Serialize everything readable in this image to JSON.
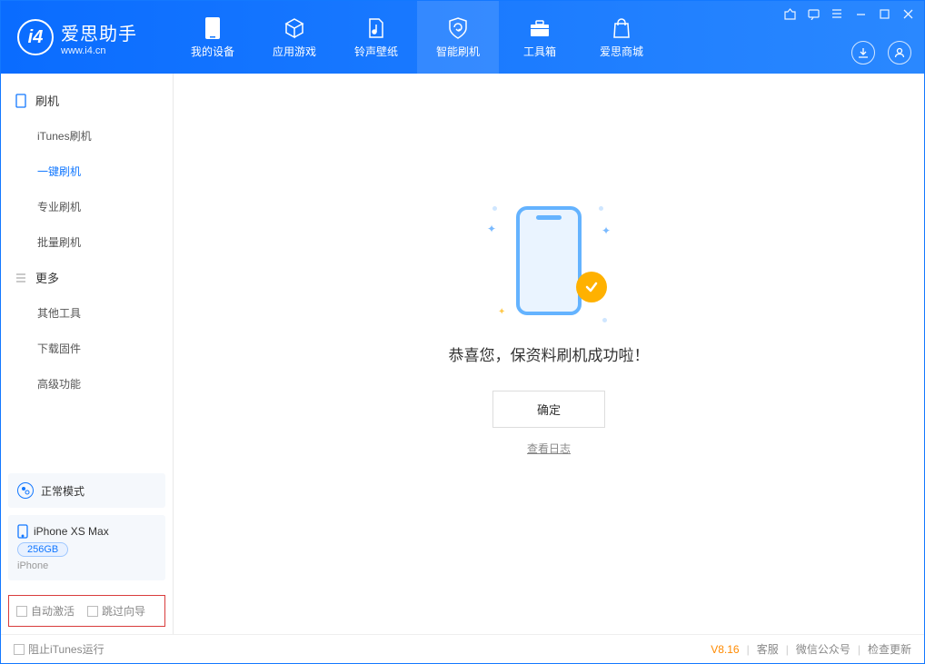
{
  "app": {
    "title": "爱思助手",
    "url": "www.i4.cn"
  },
  "nav": [
    {
      "label": "我的设备"
    },
    {
      "label": "应用游戏"
    },
    {
      "label": "铃声壁纸"
    },
    {
      "label": "智能刷机",
      "active": true
    },
    {
      "label": "工具箱"
    },
    {
      "label": "爱思商城"
    }
  ],
  "sidebar": {
    "sections": [
      {
        "title": "刷机",
        "items": [
          "iTunes刷机",
          "一键刷机",
          "专业刷机",
          "批量刷机"
        ],
        "activeIndex": 1
      },
      {
        "title": "更多",
        "items": [
          "其他工具",
          "下载固件",
          "高级功能"
        ],
        "activeIndex": -1
      }
    ],
    "mode_label": "正常模式",
    "device": {
      "name": "iPhone XS Max",
      "storage": "256GB",
      "type": "iPhone"
    },
    "checks": {
      "auto_activate": "自动激活",
      "skip_guide": "跳过向导"
    }
  },
  "main": {
    "success": "恭喜您，保资料刷机成功啦！",
    "ok": "确定",
    "view_logs": "查看日志"
  },
  "footer": {
    "block_itunes": "阻止iTunes运行",
    "version": "V8.16",
    "links": [
      "客服",
      "微信公众号",
      "检查更新"
    ]
  },
  "colors": {
    "primary": "#1378ff",
    "accent": "#ffb100",
    "highlight_border": "#d93c3c"
  }
}
